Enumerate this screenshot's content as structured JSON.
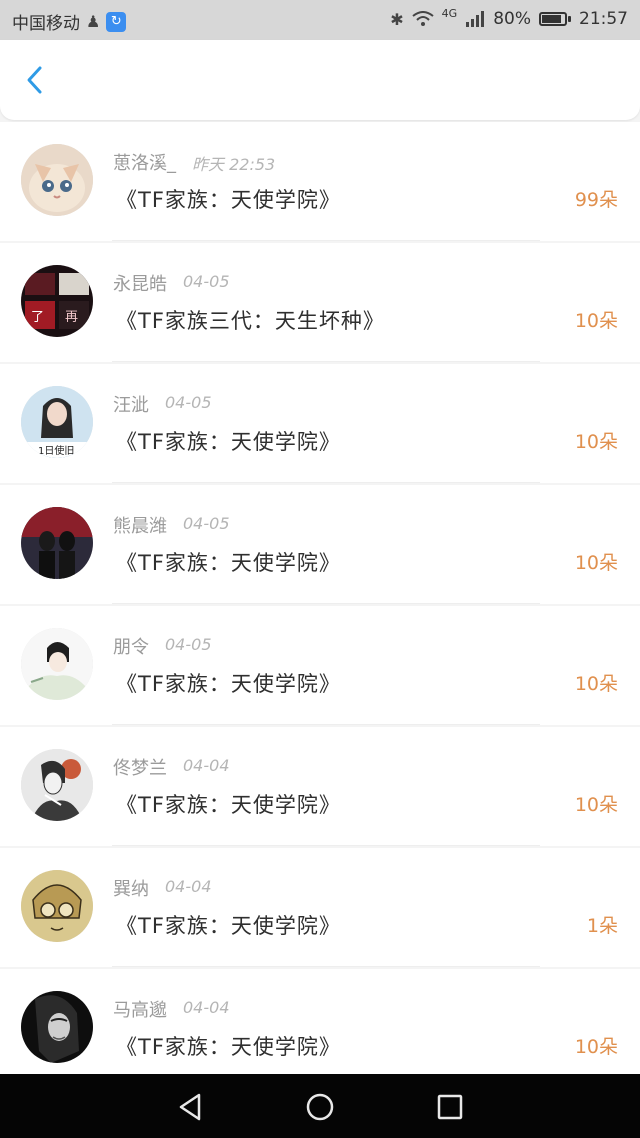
{
  "status_bar": {
    "carrier": "中国移动",
    "network": "4G",
    "battery": "80%",
    "time": "21:57",
    "battery_level": 0.8
  },
  "colors": {
    "accent": "#2f9be6",
    "count": "#e0904e",
    "name": "#9b9b9b",
    "date": "#b5b5b5",
    "title": "#2f2f2f"
  },
  "nav": {
    "back_icon": "chevron-left-icon"
  },
  "items": [
    {
      "name": "葸洛溪_",
      "date": "昨天 22:53",
      "title": "《TF家族：天使学院》",
      "count": "99朵",
      "avatar": "cat"
    },
    {
      "name": "永昆皓",
      "date": "04-05",
      "title": "《TF家族三代：天生坏种》",
      "count": "10朵",
      "avatar": "collage"
    },
    {
      "name": "汪泚",
      "date": "04-05",
      "title": "《TF家族：天使学院》",
      "count": "10朵",
      "avatar": "girl-blue",
      "avatar_caption": "1日使旧"
    },
    {
      "name": "熊晨潍",
      "date": "04-05",
      "title": "《TF家族：天使学院》",
      "count": "10朵",
      "avatar": "dark-scene"
    },
    {
      "name": "朋令",
      "date": "04-05",
      "title": "《TF家族：天使学院》",
      "count": "10朵",
      "avatar": "anime-boy"
    },
    {
      "name": "佟梦兰",
      "date": "04-04",
      "title": "《TF家族：天使学院》",
      "count": "10朵",
      "avatar": "sketch"
    },
    {
      "name": "巽纳",
      "date": "04-04",
      "title": "《TF家族：天使学院》",
      "count": "1朵",
      "avatar": "manga"
    },
    {
      "name": "马高邈",
      "date": "04-04",
      "title": "《TF家族：天使学院》",
      "count": "10朵",
      "avatar": "bw-portrait"
    }
  ],
  "system_nav": {
    "back": "triangle-back-icon",
    "home": "circle-home-icon",
    "recent": "square-recent-icon"
  }
}
